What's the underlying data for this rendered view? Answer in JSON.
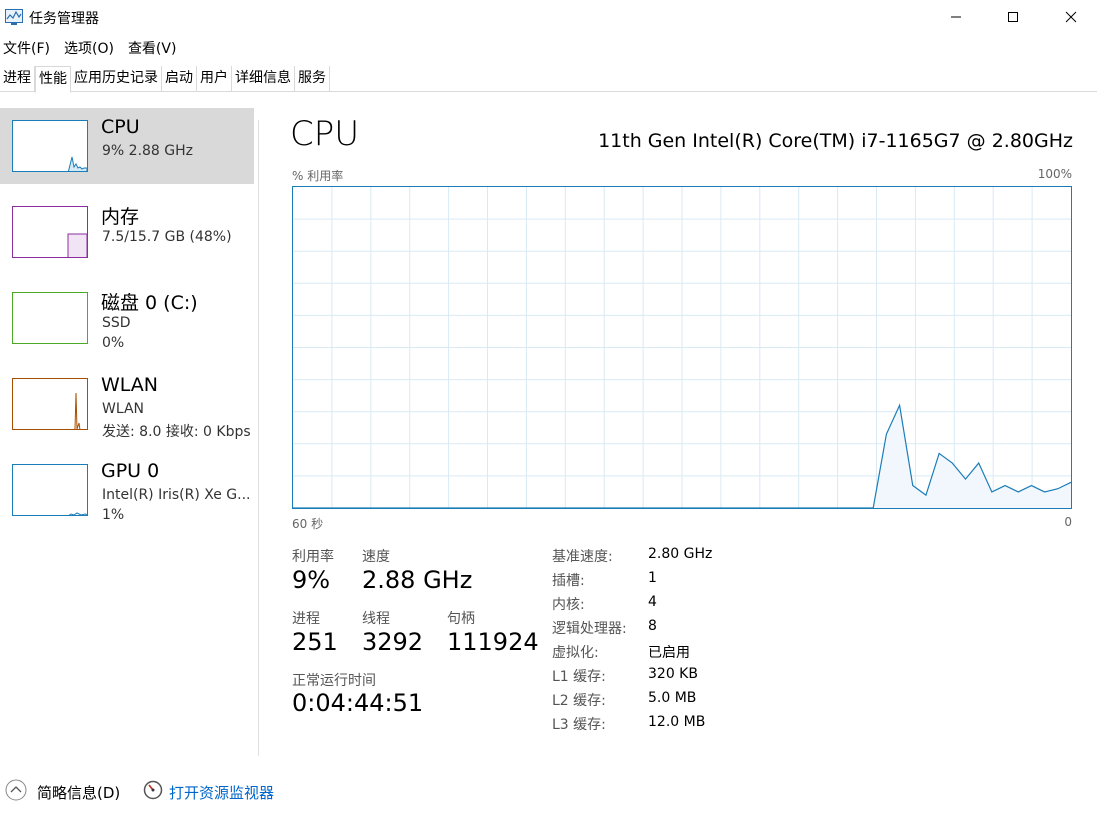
{
  "window": {
    "title": "任务管理器",
    "icon": "task-manager-icon"
  },
  "menu": [
    "文件(F)",
    "选项(O)",
    "查看(V)"
  ],
  "tabs": [
    {
      "label": "进程",
      "active": false
    },
    {
      "label": "性能",
      "active": true
    },
    {
      "label": "应用历史记录",
      "active": false
    },
    {
      "label": "启动",
      "active": false
    },
    {
      "label": "用户",
      "active": false
    },
    {
      "label": "详细信息",
      "active": false
    },
    {
      "label": "服务",
      "active": false
    }
  ],
  "sidebar": [
    {
      "name": "CPU",
      "line1": "9% 2.88 GHz",
      "line2": "",
      "color": "#1b7db8",
      "selected": true
    },
    {
      "name": "内存",
      "line1": "7.5/15.7 GB (48%)",
      "line2": "",
      "color": "#8b2fa0",
      "selected": false
    },
    {
      "name": "磁盘 0 (C:)",
      "line1": "SSD",
      "line2": "0%",
      "color": "#4caa26",
      "selected": false
    },
    {
      "name": "WLAN",
      "line1": "WLAN",
      "line2": "发送: 8.0 接收: 0 Kbps",
      "color": "#a74f01",
      "selected": false
    },
    {
      "name": "GPU 0",
      "line1": "Intel(R) Iris(R) Xe G...",
      "line2": "1%",
      "color": "#1b7db8",
      "selected": false
    }
  ],
  "main": {
    "title": "CPU",
    "model": "11th Gen Intel(R) Core(TM) i7-1165G7 @ 2.80GHz",
    "util_label": "% 利用率",
    "max_label": "100%",
    "time_label": "60 秒",
    "zero_label": "0"
  },
  "stats": {
    "util_label": "利用率",
    "util_value": "9%",
    "speed_label": "速度",
    "speed_value": "2.88 GHz",
    "proc_label": "进程",
    "proc_value": "251",
    "threads_label": "线程",
    "threads_value": "3292",
    "handles_label": "句柄",
    "handles_value": "111924",
    "uptime_label": "正常运行时间",
    "uptime_value": "0:04:44:51"
  },
  "specs": [
    {
      "label": "基准速度:",
      "value": "2.80 GHz"
    },
    {
      "label": "插槽:",
      "value": "1"
    },
    {
      "label": "内核:",
      "value": "4"
    },
    {
      "label": "逻辑处理器:",
      "value": "8"
    },
    {
      "label": "虚拟化:",
      "value": "已启用"
    },
    {
      "label": "L1 缓存:",
      "value": "320 KB"
    },
    {
      "label": "L2 缓存:",
      "value": "5.0 MB"
    },
    {
      "label": "L3 缓存:",
      "value": "12.0 MB"
    }
  ],
  "footer": {
    "less_info": "简略信息(D)",
    "open_monitor": "打开资源监视器"
  },
  "chart_data": {
    "type": "area",
    "x_range": [
      60,
      0
    ],
    "ylim": [
      0,
      100
    ],
    "grid": true,
    "values": [
      0,
      0,
      0,
      0,
      0,
      0,
      0,
      0,
      0,
      0,
      0,
      0,
      0,
      0,
      0,
      0,
      0,
      0,
      0,
      0,
      0,
      0,
      0,
      0,
      0,
      0,
      0,
      0,
      0,
      0,
      0,
      0,
      0,
      0,
      0,
      0,
      0,
      0,
      0,
      0,
      0,
      0,
      0,
      0,
      0,
      23,
      32,
      7,
      4,
      17,
      14,
      9,
      14,
      5,
      7,
      5,
      7,
      5,
      6,
      8
    ],
    "color": "#1b7db8"
  }
}
